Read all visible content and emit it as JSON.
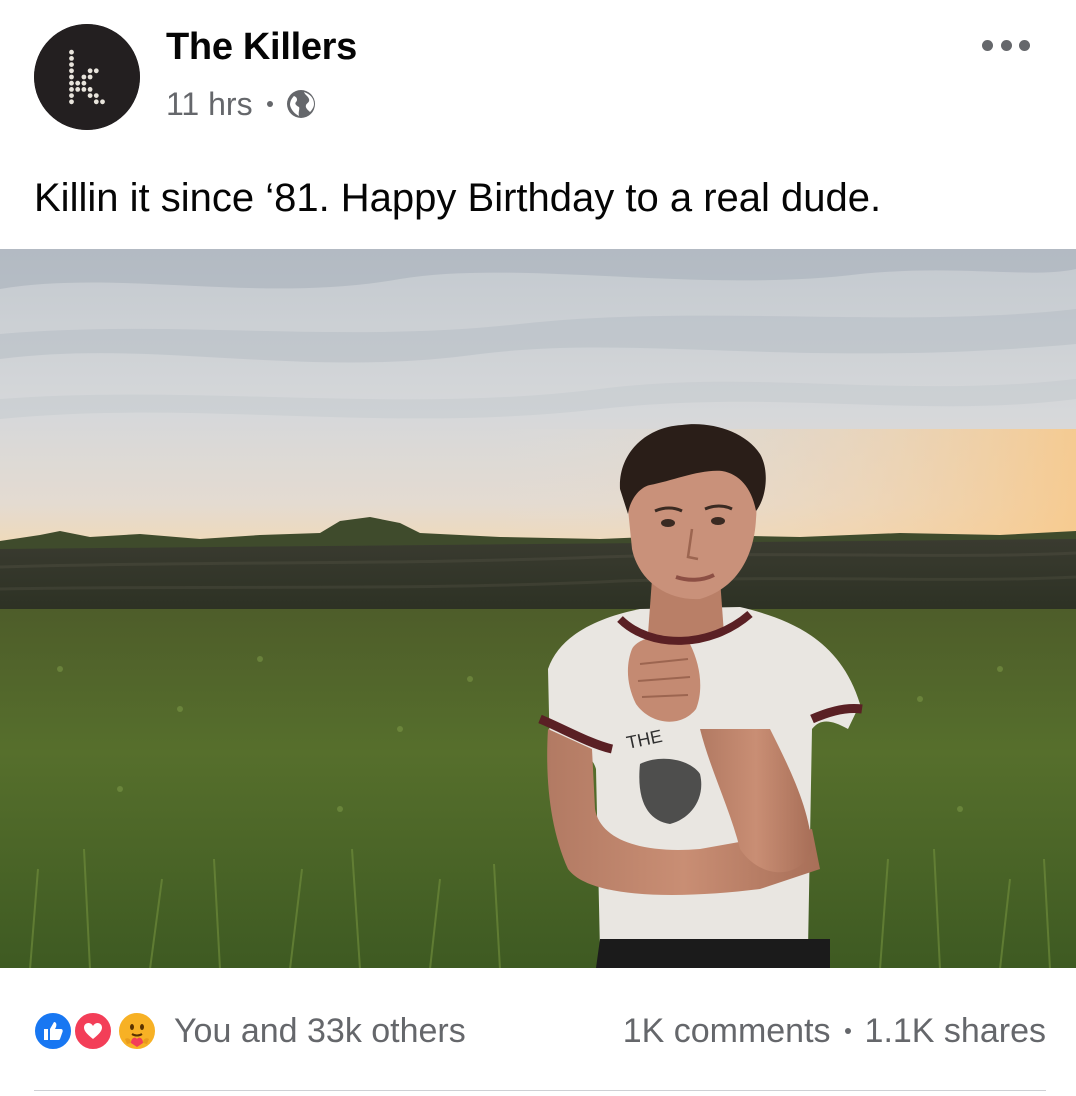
{
  "post": {
    "author": "The Killers",
    "timestamp": "11 hrs",
    "privacy_icon": "globe-icon",
    "caption": "Killin it since ‘81. Happy Birthday to a real dude."
  },
  "avatar": {
    "letter": "k",
    "background": "#231f20",
    "dot_color": "#e8e4dc"
  },
  "photo": {
    "subject": "man in white ringer t-shirt standing in a grassy field at dusk",
    "shirt_text": "THE"
  },
  "reactions": {
    "icons": [
      "like-icon",
      "love-icon",
      "care-icon"
    ],
    "summary": "You and 33k others"
  },
  "stats": {
    "comments": "1K comments",
    "shares": "1.1K shares"
  },
  "colors": {
    "like": "#1877f2",
    "love": "#f33e58",
    "care": "#f7b125",
    "secondary_text": "#65676b"
  }
}
